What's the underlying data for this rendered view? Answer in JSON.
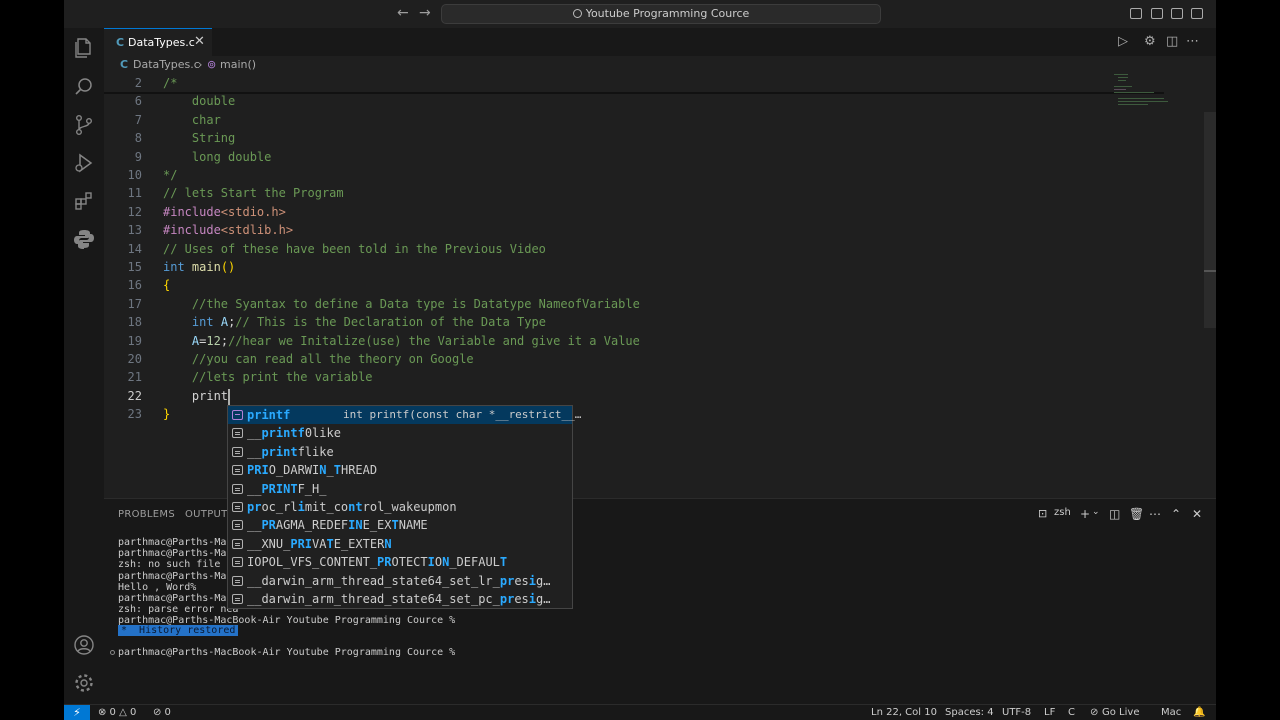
{
  "titlebar": {
    "search_text": "Youtube Programming Cource",
    "back_icon": "←",
    "forward_icon": "→"
  },
  "tabs": [
    {
      "badge": "C",
      "label": "DataTypes.c",
      "close": "✕",
      "active": true
    }
  ],
  "breadcrumb": {
    "badge": "C",
    "file": "DataTypes.c",
    "separator": "›",
    "symbol_icon": "⊚",
    "symbol": "main()"
  },
  "editor": {
    "lines": [
      {
        "n": "2",
        "tokens": [
          {
            "t": "/*",
            "c": "cm"
          }
        ]
      },
      {
        "n": "6",
        "tokens": [
          {
            "t": "    double",
            "c": "cm"
          }
        ]
      },
      {
        "n": "7",
        "tokens": [
          {
            "t": "    char",
            "c": "cm"
          }
        ]
      },
      {
        "n": "8",
        "tokens": [
          {
            "t": "    String",
            "c": "cm"
          }
        ]
      },
      {
        "n": "9",
        "tokens": [
          {
            "t": "    long double",
            "c": "cm"
          }
        ]
      },
      {
        "n": "10",
        "tokens": [
          {
            "t": "*/",
            "c": "cm"
          }
        ]
      },
      {
        "n": "11",
        "tokens": [
          {
            "t": "// lets Start the Program",
            "c": "cm"
          }
        ]
      },
      {
        "n": "12",
        "tokens": [
          {
            "t": "#include",
            "c": "pp"
          },
          {
            "t": "<stdio.h>",
            "c": "str"
          }
        ]
      },
      {
        "n": "13",
        "tokens": [
          {
            "t": "#include",
            "c": "pp"
          },
          {
            "t": "<stdlib.h>",
            "c": "str"
          }
        ]
      },
      {
        "n": "14",
        "tokens": [
          {
            "t": "// Uses of these have been told in the Previous Video",
            "c": "cm"
          }
        ]
      },
      {
        "n": "15",
        "tokens": [
          {
            "t": "int",
            "c": "kw"
          },
          {
            "t": " ",
            "c": "txt"
          },
          {
            "t": "main",
            "c": "fn"
          },
          {
            "t": "()",
            "c": "br"
          }
        ]
      },
      {
        "n": "16",
        "tokens": [
          {
            "t": "{",
            "c": "br"
          }
        ]
      },
      {
        "n": "17",
        "tokens": [
          {
            "t": "    //the Syantax to define a Data type is Datatype NameofVariable",
            "c": "cm"
          }
        ]
      },
      {
        "n": "18",
        "tokens": [
          {
            "t": "    ",
            "c": "txt"
          },
          {
            "t": "int",
            "c": "kw"
          },
          {
            "t": " ",
            "c": "txt"
          },
          {
            "t": "A",
            "c": "var"
          },
          {
            "t": ";",
            "c": "txt"
          },
          {
            "t": "// This is the Declaration of the Data Type",
            "c": "cm"
          }
        ]
      },
      {
        "n": "19",
        "tokens": [
          {
            "t": "    ",
            "c": "txt"
          },
          {
            "t": "A",
            "c": "var"
          },
          {
            "t": "=",
            "c": "txt"
          },
          {
            "t": "12",
            "c": "num"
          },
          {
            "t": ";",
            "c": "txt"
          },
          {
            "t": "//hear we Initalize(use) the Variable and give it a Value",
            "c": "cm"
          }
        ]
      },
      {
        "n": "20",
        "tokens": [
          {
            "t": "    //you can read all the theory on Google",
            "c": "cm"
          }
        ]
      },
      {
        "n": "21",
        "tokens": [
          {
            "t": "    //lets print the variable",
            "c": "cm"
          }
        ]
      },
      {
        "n": "22",
        "tokens": [
          {
            "t": "    print",
            "c": "txt"
          }
        ],
        "current": true
      },
      {
        "n": "23",
        "tokens": [
          {
            "t": "}",
            "c": "br"
          }
        ]
      }
    ]
  },
  "suggest": {
    "items": [
      {
        "icon": "cube",
        "parts": [
          {
            "t": "printf",
            "h": true
          }
        ],
        "detail": "int printf(const char *__restrict__…",
        "selected": true
      },
      {
        "icon": "list",
        "parts": [
          {
            "t": "__",
            "h": false
          },
          {
            "t": "printf",
            "h": true
          },
          {
            "t": "0like",
            "h": false
          }
        ]
      },
      {
        "icon": "list",
        "parts": [
          {
            "t": "__",
            "h": false
          },
          {
            "t": "print",
            "h": true
          },
          {
            "t": "flike",
            "h": false
          }
        ]
      },
      {
        "icon": "list",
        "parts": [
          {
            "t": "PRI",
            "h": true
          },
          {
            "t": "O_DARWI",
            "h": false
          },
          {
            "t": "N",
            "h": true
          },
          {
            "t": "_",
            "h": false
          },
          {
            "t": "T",
            "h": true
          },
          {
            "t": "HREAD",
            "h": false
          }
        ]
      },
      {
        "icon": "list",
        "parts": [
          {
            "t": "__",
            "h": false
          },
          {
            "t": "PRINT",
            "h": true
          },
          {
            "t": "F_H_",
            "h": false
          }
        ]
      },
      {
        "icon": "list",
        "parts": [
          {
            "t": "pr",
            "h": true
          },
          {
            "t": "oc_rl",
            "h": false
          },
          {
            "t": "i",
            "h": true
          },
          {
            "t": "mit_co",
            "h": false
          },
          {
            "t": "nt",
            "h": true
          },
          {
            "t": "rol_wakeupmon",
            "h": false
          }
        ]
      },
      {
        "icon": "list",
        "parts": [
          {
            "t": "__",
            "h": false
          },
          {
            "t": "PR",
            "h": true
          },
          {
            "t": "AGMA_REDEF",
            "h": false
          },
          {
            "t": "IN",
            "h": true
          },
          {
            "t": "E_EX",
            "h": false
          },
          {
            "t": "T",
            "h": true
          },
          {
            "t": "NAME",
            "h": false
          }
        ]
      },
      {
        "icon": "list",
        "parts": [
          {
            "t": "__XNU_",
            "h": false
          },
          {
            "t": "PRI",
            "h": true
          },
          {
            "t": "VA",
            "h": false
          },
          {
            "t": "T",
            "h": true
          },
          {
            "t": "E_EXTER",
            "h": false
          },
          {
            "t": "N",
            "h": true
          }
        ]
      },
      {
        "icon": "list",
        "parts": [
          {
            "t": "IOPOL_VFS_CONTENT_",
            "h": false
          },
          {
            "t": "PR",
            "h": true
          },
          {
            "t": "OTECT",
            "h": false
          },
          {
            "t": "I",
            "h": true
          },
          {
            "t": "O",
            "h": false
          },
          {
            "t": "N",
            "h": true
          },
          {
            "t": "_DEFAUL",
            "h": false
          },
          {
            "t": "T",
            "h": true
          }
        ]
      },
      {
        "icon": "list",
        "parts": [
          {
            "t": "__darwin_arm_thread_state64_set_lr_",
            "h": false
          },
          {
            "t": "pr",
            "h": true
          },
          {
            "t": "es",
            "h": false
          },
          {
            "t": "i",
            "h": true
          },
          {
            "t": "g…",
            "h": false
          }
        ]
      },
      {
        "icon": "list",
        "parts": [
          {
            "t": "__darwin_arm_thread_state64_set_pc_",
            "h": false
          },
          {
            "t": "pr",
            "h": true
          },
          {
            "t": "es",
            "h": false
          },
          {
            "t": "i",
            "h": true
          },
          {
            "t": "g…",
            "h": false
          }
        ]
      }
    ]
  },
  "panel": {
    "tabs": [
      "PROBLEMS",
      "OUTPUT"
    ],
    "shell": "zsh",
    "terminal_lines": [
      "parthmac@Parths-MacB",
      "parthmac@Parths-MacB",
      "zsh: no such file or",
      "parthmac@Parths-MacB",
      "Hello , Word%",
      "parthmac@Parths-MacB",
      "zsh: parse error nea",
      "parthmac@Parths-MacBook-Air Youtube Programming Cource %"
    ],
    "history_label": "*  History restored",
    "prompt_line": "parthmac@Parths-MacBook-Air Youtube Programming Cource %"
  },
  "statusbar": {
    "remote_icon": "⚡",
    "errors": "⊗ 0 △ 0",
    "ports": "⊘ 0",
    "position": "Ln 22, Col 10",
    "spaces": "Spaces: 4",
    "encoding": "UTF-8",
    "eol": "LF",
    "language": "C",
    "golive": "Go Live",
    "platform": "Mac"
  },
  "colors": {
    "accent": "#0078d4",
    "suggest_selected": "#04395e",
    "match_highlight": "#2aaaff"
  }
}
